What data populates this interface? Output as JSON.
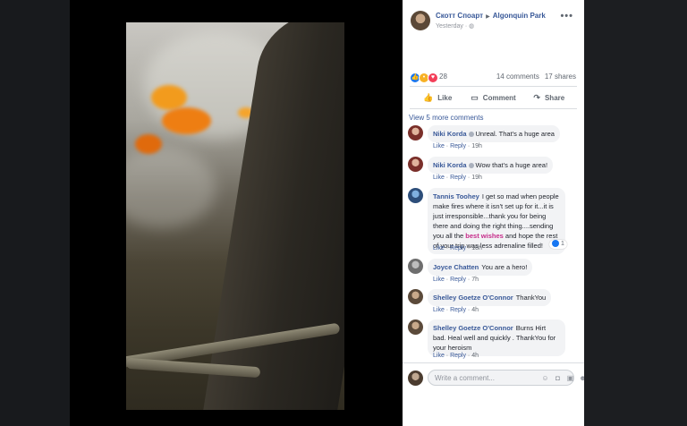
{
  "post": {
    "author": "Скотт Споарт",
    "page": "Algonquin Park",
    "time": "Yesterday",
    "more": "•••",
    "reaction_count": "28",
    "comments": "14 comments",
    "shares": "17 shares",
    "actions": {
      "like": "Like",
      "comment": "Comment",
      "share": "Share"
    },
    "view_more": "View 5 more comments"
  },
  "comments": [
    {
      "name": "Niki Korda",
      "text": "Unreal. That's a huge area",
      "like": "Like",
      "reply": "Reply",
      "time": "19h"
    },
    {
      "name": "Niki Korda",
      "text": "Wow that's a huge area!",
      "like": "Like",
      "reply": "Reply",
      "time": "19h"
    },
    {
      "name": "Tannis Toohey",
      "text_a": "I get so mad when people make fires where it isn't set up for it...it is just irresponsible...thank you for being there and doing the right thing....sending you all the",
      "highlight": "best wishes",
      "text_b": "and hope the rest of your trip was less adrenaline filled!",
      "like": "Like",
      "reply": "Reply",
      "time": "18h",
      "likes": "1"
    },
    {
      "name": "Joyce Chatten",
      "text": "You are a hero!",
      "like": "Like",
      "reply": "Reply",
      "time": "7h"
    },
    {
      "name": "Shelley Goetze O'Connor",
      "text": "ThankYou",
      "like": "Like",
      "reply": "Reply",
      "time": "4h"
    },
    {
      "name": "Shelley Goetze O'Connor",
      "text": "Burns Hirt bad. Heal well and quickly . ThankYou for your heroism",
      "like": "Like",
      "reply": "Reply",
      "time": "4h"
    }
  ],
  "composer": {
    "placeholder": "Write a comment..."
  },
  "icons": [
    "globe-icon",
    "like-icon",
    "comment-icon",
    "share-icon",
    "emoji-icon",
    "camera-icon",
    "gif-icon",
    "sticker-icon"
  ]
}
